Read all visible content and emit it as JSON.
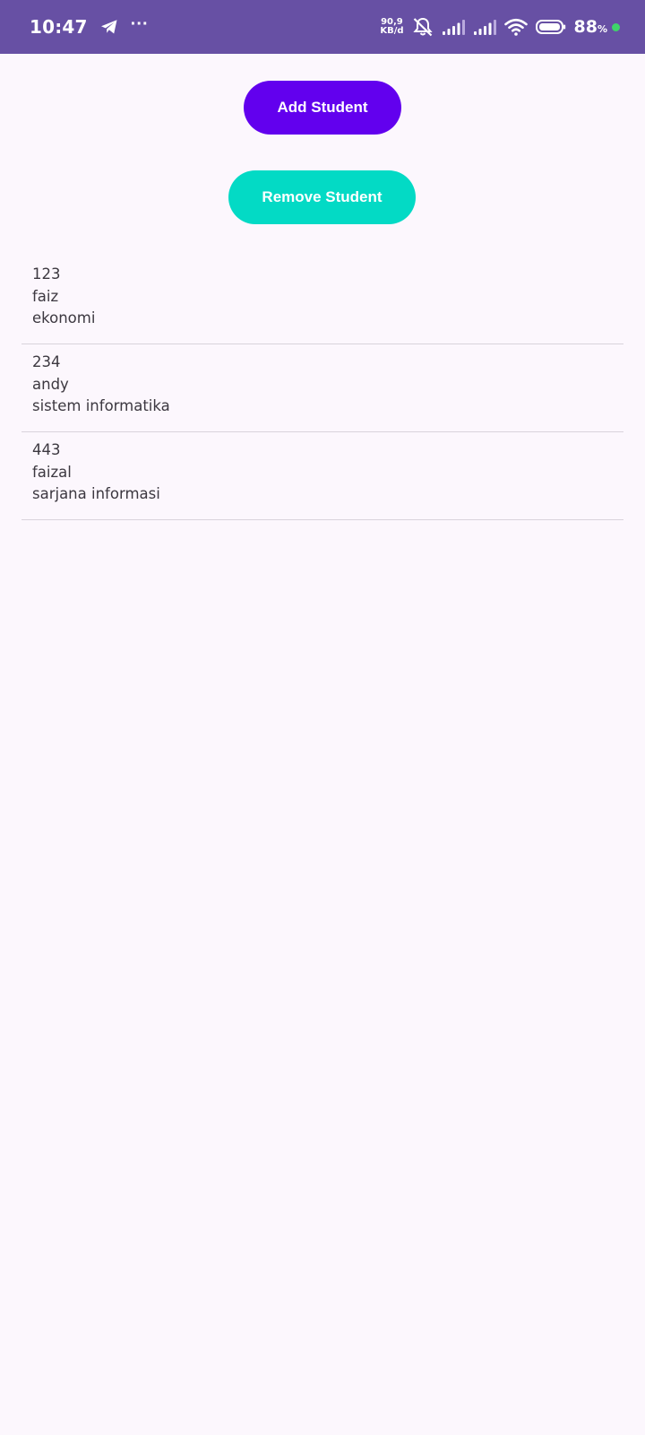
{
  "status_bar": {
    "time": "10:47",
    "overflow_dots": "···",
    "net_speed_value": "90,9",
    "net_speed_unit": "KB/d",
    "battery_percent": "88",
    "battery_percent_sign": "%",
    "icons": [
      "telegram-icon",
      "mute-icon",
      "signal-icon",
      "signal-icon",
      "wifi-icon",
      "battery-icon"
    ],
    "bar_color": "#6750a4",
    "charge_dot_color": "#3fd46a"
  },
  "buttons": {
    "add_label": "Add Student",
    "remove_label": "Remove Student",
    "add_color": "#6200ee",
    "remove_color": "#03dac5"
  },
  "students": [
    {
      "id": "123",
      "name": "faiz",
      "major": "ekonomi"
    },
    {
      "id": "234",
      "name": "andy",
      "major": "sistem informatika"
    },
    {
      "id": "443",
      "name": "faizal",
      "major": "sarjana informasi"
    }
  ]
}
